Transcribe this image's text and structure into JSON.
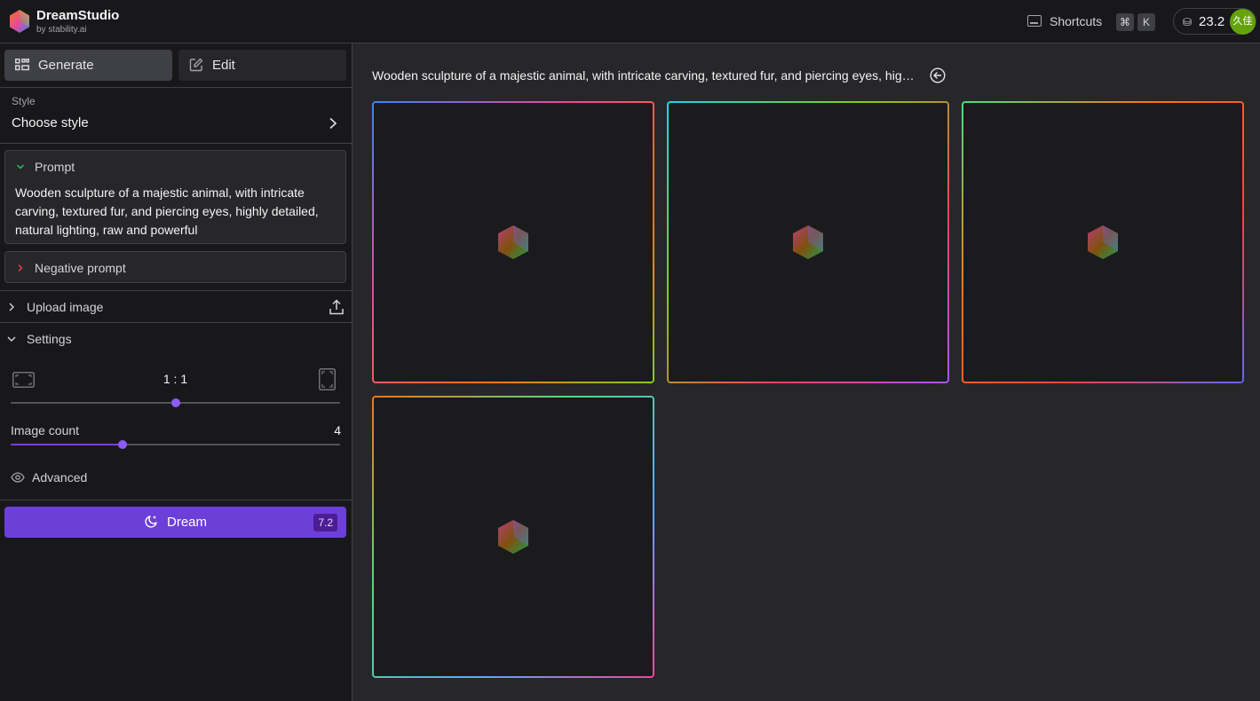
{
  "header": {
    "brand": "DreamStudio",
    "brand_sub": "by stability.ai",
    "shortcuts_label": "Shortcuts",
    "key_cmd": "⌘",
    "key_k": "K",
    "credits": "23.2",
    "avatar_text": "久佳"
  },
  "sidebar": {
    "tabs": [
      {
        "label": "Generate",
        "icon": "grid-icon",
        "active": true
      },
      {
        "label": "Edit",
        "icon": "pencil-square-icon",
        "active": false
      }
    ],
    "style": {
      "label": "Style",
      "value": "Choose style"
    },
    "prompt": {
      "label": "Prompt",
      "text": "Wooden sculpture of a majestic animal, with intricate carving, textured fur, and piercing eyes, highly detailed, natural lighting, raw and powerful"
    },
    "negative_prompt": {
      "label": "Negative prompt"
    },
    "upload_image": {
      "label": "Upload image"
    },
    "settings": {
      "label": "Settings",
      "aspect_ratio": "1 : 1",
      "aspect_slider": 0.5,
      "image_count_label": "Image count",
      "image_count": "4",
      "image_count_slider": 0.34
    },
    "advanced": {
      "label": "Advanced"
    },
    "dream": {
      "label": "Dream",
      "cost": "7.2"
    }
  },
  "main": {
    "prompt_title": "Wooden sculpture of a majestic animal, with intricate carving, textured fur, and piercing eyes, highly detailed, natural lighting, raw and powerful",
    "tiles": [
      {
        "state": "loading"
      },
      {
        "state": "loading"
      },
      {
        "state": "loading"
      },
      {
        "state": "loading"
      }
    ]
  },
  "colors": {
    "accent": "#6d3fd9",
    "slider": "#8b5cf6",
    "background": "#27272a",
    "panel": "#18181b",
    "avatar": "#65a30d"
  }
}
